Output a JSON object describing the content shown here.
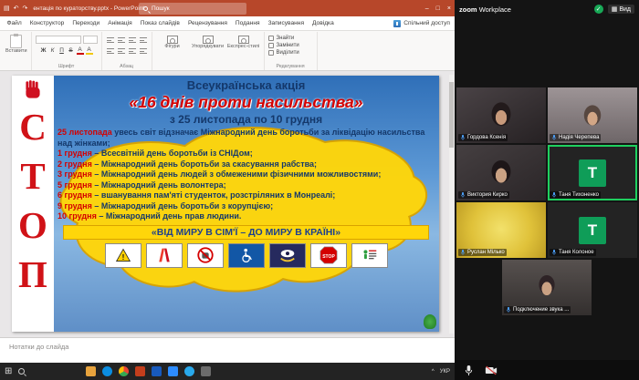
{
  "icons": {
    "save": "▤",
    "undo": "↶",
    "redo": "↷",
    "minimize": "–",
    "maximize": "□",
    "close": "×",
    "start": "⊞",
    "chevron_up": "^",
    "check": "✓",
    "grid": "▦",
    "excl": "!"
  },
  "powerpoint": {
    "titlebar": {
      "title": "ентація по кураторству.pptx - PowerPoint",
      "search": "Пошук"
    },
    "tabs": [
      "Файл",
      "Конструктор",
      "Переходи",
      "Анімація",
      "Показ слайдів",
      "Рецензування",
      "Подання",
      "Записування",
      "Довідка"
    ],
    "share_label": "Спільний доступ",
    "ribbon": {
      "paste_label": "Вставити",
      "font_buttons": [
        "Ж",
        "К",
        "П",
        "S",
        "А",
        "А"
      ],
      "shapes_label": "Фігури",
      "arrange_label": "Упорядкувати",
      "styles_label": "Експрес-стилі",
      "find_label": "Знайти",
      "replace_label": "Замінити",
      "select_label": "Виділити",
      "group_font": "Шрифт",
      "group_paragraph": "Абзац",
      "group_editing": "Редагування"
    },
    "notes_placeholder": "Нотатки до слайда"
  },
  "slide": {
    "stop_letters": [
      "С",
      "Т",
      "О",
      "П"
    ],
    "header": "Всеукраїнська акція",
    "title": "«16 днів проти насильства»",
    "subtitle": "з 25 листопада по 10 грудня",
    "intro_date": "25 листопада",
    "intro_text": "увесь світ відзначає Міжнародний день боротьби за ліквідацію насильства над жінками;",
    "items": [
      {
        "date": "1 грудня",
        "text": "– Всесвітній день боротьби із СНІДом;"
      },
      {
        "date": "2 грудня",
        "text": "– Міжнародний день боротьби за скасування рабства;"
      },
      {
        "date": "3 грудня",
        "text": "– Міжнародний день людей з обмеженими фізичними можливостями;"
      },
      {
        "date": "5 грудня",
        "text": "– Міжнародний день волонтера;"
      },
      {
        "date": "6 грудня",
        "text": "– вшанування пам'яті студенток, розстріляних в Монреалі;"
      },
      {
        "date": "9 грудня",
        "text": "– Міжнародний день боротьби з корупцією;"
      },
      {
        "date": "10 грудня",
        "text": "– Міжнародний день прав людини."
      }
    ],
    "banner": "«ВІД МИРУ В СІМ'Ї – ДО МИРУ В КРАЇНІ»",
    "stop_sign_text": "STOP"
  },
  "zoom": {
    "brand_bold": "zoom",
    "brand_rest": "Workplace",
    "view_label": "Вид",
    "participants": [
      {
        "name": "Гордова Ксенія"
      },
      {
        "name": "Надія Черепева"
      },
      {
        "name": "Виктория Кирко"
      },
      {
        "name": "Таня Тихоненко",
        "initial": "Т"
      },
      {
        "name": "Руслан Мілько"
      },
      {
        "name": "Таня Колоное",
        "initial": "Т"
      },
      {
        "name": "Подключение звука ..."
      }
    ]
  },
  "taskbar": {
    "tray_lang": "УКР"
  }
}
